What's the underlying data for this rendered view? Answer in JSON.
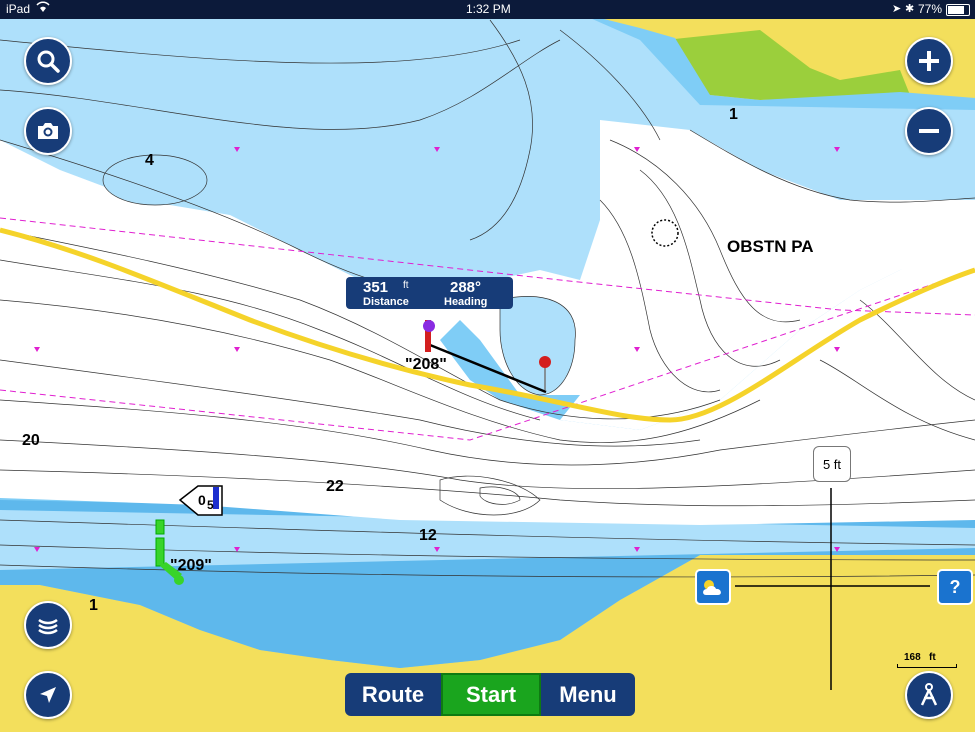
{
  "status_bar": {
    "device": "iPad",
    "time": "1:32 PM",
    "battery": "77%"
  },
  "map_labels": {
    "depth_4": "4",
    "depth_1_top": "1",
    "depth_20": "20",
    "depth_22": "22",
    "depth_12": "12",
    "depth_1_bottom": "1",
    "obstruction": "OBSTN PA",
    "marker_208": "\"208\"",
    "marker_209": "\"209\"",
    "buoy_0": "0",
    "buoy_5": "5"
  },
  "measure": {
    "distance_value": "351",
    "distance_unit": "ft",
    "distance_label": "Distance",
    "heading_value": "288°",
    "heading_label": "Heading"
  },
  "depth_indicator": "5 ft",
  "scale": {
    "value": "168",
    "unit": "ft"
  },
  "bottom_bar": {
    "route_label": "Route",
    "start_label": "Start",
    "menu_label": "Menu"
  },
  "help_label": "?",
  "icons": [
    "search-icon",
    "camera-icon",
    "zoom-in-icon",
    "zoom-out-icon",
    "sonar-icon",
    "location-arrow-icon",
    "anchor-person-icon",
    "weather-icon",
    "help-icon"
  ],
  "colors": {
    "land": "#f3df5c",
    "marsh": "#9bcf3c",
    "shallow": "#ffffff",
    "mid": "#aee0fb",
    "deep": "#7fcdf6",
    "deeper": "#5eb8ec",
    "route": "#f5d32a",
    "button": "#173c78",
    "start": "#1aa51e"
  }
}
